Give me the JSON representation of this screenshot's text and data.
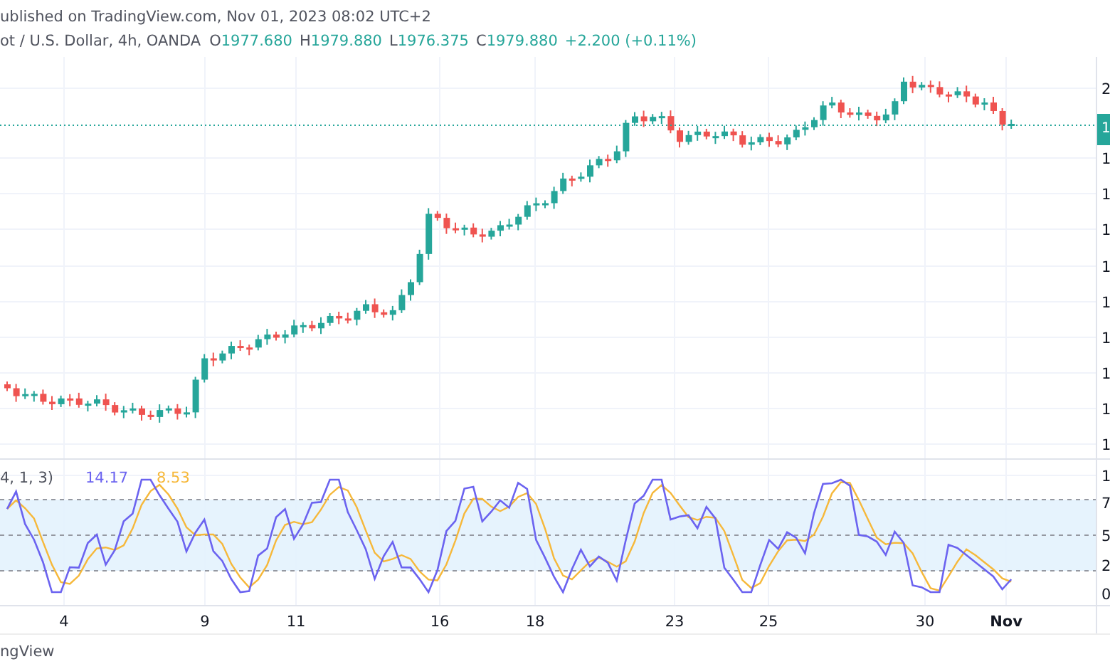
{
  "header": {
    "published": "ublished on TradingView.com, Nov 01, 2023 08:02 UTC+2",
    "symbol": "ot / U.S. Dollar, 4h, OANDA",
    "ohlc": [
      {
        "label": "O",
        "value": "1977.680"
      },
      {
        "label": "H",
        "value": "1979.880"
      },
      {
        "label": "L",
        "value": "1976.375"
      },
      {
        "label": "C",
        "value": "1979.880"
      }
    ],
    "change": "+2.200 (+0.11%)"
  },
  "price_axis": {
    "labels": [
      "2",
      "1",
      "1",
      "1",
      "1",
      "1",
      "1",
      "1",
      "1",
      "1"
    ],
    "badge": "1"
  },
  "stochastic": {
    "params": "4, 1, 3)",
    "k_value": "14.17",
    "d_value": "8.53",
    "axis_labels": [
      "1",
      "7",
      "5",
      "2",
      "0"
    ]
  },
  "x_axis": [
    {
      "label": "4",
      "kind": "day"
    },
    {
      "label": "9",
      "kind": "day"
    },
    {
      "label": "11",
      "kind": "day"
    },
    {
      "label": "16",
      "kind": "day"
    },
    {
      "label": "18",
      "kind": "day"
    },
    {
      "label": "23",
      "kind": "day"
    },
    {
      "label": "25",
      "kind": "day"
    },
    {
      "label": "30",
      "kind": "day"
    },
    {
      "label": "Nov",
      "kind": "month"
    }
  ],
  "footer": "ngView"
}
